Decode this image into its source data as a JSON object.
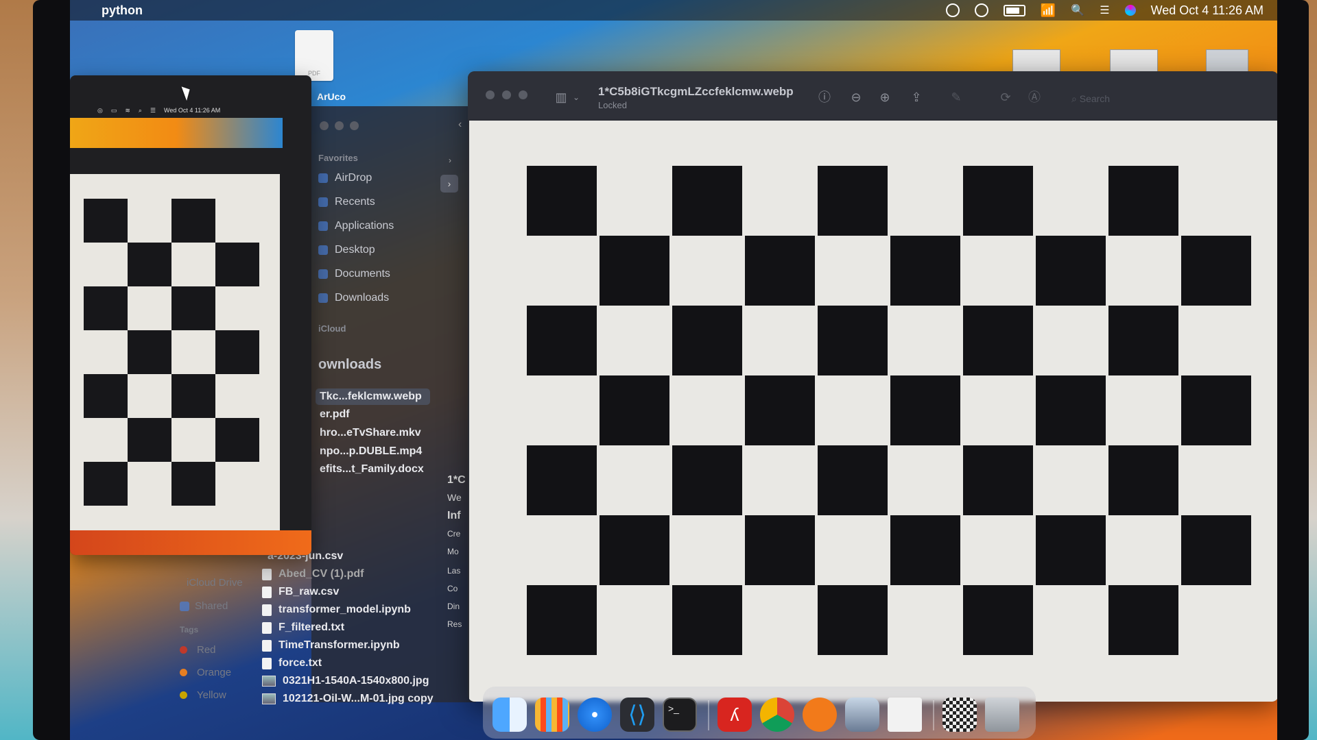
{
  "menubar": {
    "app_name": "python",
    "datetime": "Wed Oct 4  11:26 AM",
    "icons": [
      "apple-icon",
      "record-icon",
      "play-icon",
      "battery-icon",
      "wifi-icon",
      "search-icon",
      "control-center-icon",
      "siri-icon"
    ]
  },
  "desktop": {
    "pdf_label": "PDF",
    "folder_label": "ArUco"
  },
  "left_preview": {
    "mini_menubar_time": "Wed Oct 4  11:26 AM"
  },
  "finder": {
    "favorites_label": "Favorites",
    "favorites": [
      "AirDrop",
      "Recents",
      "Applications",
      "Desktop",
      "Documents",
      "Downloads"
    ],
    "icloud_label": "iCloud",
    "heading": "ownloads",
    "files": [
      "Tkc...feklcmw.webp",
      "er.pdf",
      "hro...eTvShare.mkv",
      "npo...p.DUBLE.mp4",
      "efits...t_Family.docx"
    ],
    "lower_files": [
      "a-2023-jun.csv",
      "Abed_CV (1).pdf",
      "FB_raw.csv",
      "transformer_model.ipynb",
      "F_filtered.txt",
      "TimeTransformer.ipynb",
      "force.txt",
      "0321H1-1540A-1540x800.jpg",
      "102121-Oil-W...M-01.jpg copy"
    ],
    "lower_sidebar": {
      "icloud_drive": "iCloud Drive",
      "shared": "Shared",
      "tags_label": "Tags",
      "tags": [
        {
          "label": "Red",
          "color": "#c0392b"
        },
        {
          "label": "Orange",
          "color": "#e67e22"
        },
        {
          "label": "Yellow",
          "color": "#c8a400"
        }
      ]
    },
    "info_snippets": [
      "1*C",
      "We",
      "Inf",
      "Cre",
      "Mo",
      "Las",
      "Co",
      "Din",
      "Res"
    ]
  },
  "preview": {
    "title": "1*C5b8iGTkcgmLZccfeklcmw.webp",
    "subtitle": "Locked",
    "search_placeholder": "Search",
    "toolbar_icons": [
      "sidebar-toggle-icon",
      "info-icon",
      "zoom-out-icon",
      "zoom-in-icon",
      "share-icon",
      "markup-icon",
      "rotate-icon",
      "annotate-icon"
    ]
  },
  "dock": {
    "apps": [
      "Finder",
      "Launchpad",
      "Safari",
      "Visual Studio Code",
      "Terminal",
      "Adobe Acrobat",
      "Google Chrome",
      "VLC",
      "Preview",
      "Document",
      "Checkerboard",
      "Trash"
    ]
  }
}
